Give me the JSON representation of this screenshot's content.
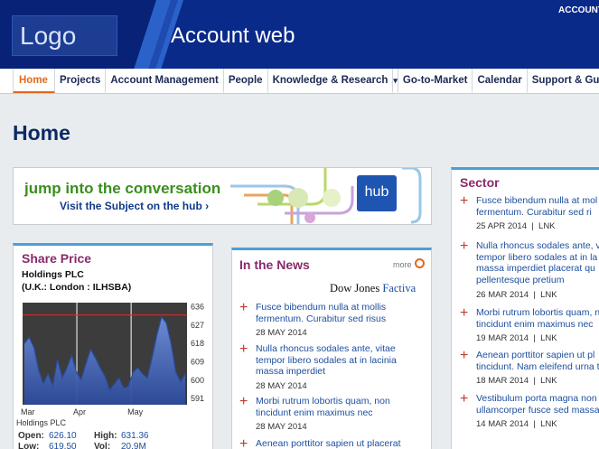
{
  "header": {
    "logo": "Logo",
    "title": "Account web",
    "account_link": "ACCOUNT"
  },
  "nav": {
    "items": [
      "Home",
      "Projects",
      "Account Management",
      "People",
      "Knowledge & Research",
      "▾",
      "Go-to-Market",
      "Calendar",
      "Support & Gu"
    ]
  },
  "page": {
    "title": "Home"
  },
  "banner": {
    "headline": "jump into the conversation",
    "subline": "Visit the Subject on the hub ›",
    "badge": "hub"
  },
  "share_price": {
    "title": "Share Price",
    "company": "Holdings PLC",
    "exchange": "(U.K.: London : ILHSBA)",
    "chart_data": {
      "type": "area",
      "x_labels": [
        "Mar",
        "Apr",
        "May"
      ],
      "y_ticks": [
        591,
        600,
        609,
        618,
        627,
        636
      ],
      "ylim": [
        588,
        638
      ],
      "values": [
        618,
        621,
        616,
        605,
        598,
        603,
        597,
        610,
        601,
        606,
        612,
        604,
        600,
        608,
        615,
        611,
        606,
        602,
        595,
        598,
        601,
        596,
        597,
        604,
        606,
        603,
        601,
        611,
        622,
        631,
        628,
        618,
        604,
        599,
        603
      ],
      "legend": "Holdings PLC",
      "colors": {
        "fill": "#4f78c8",
        "line": "#2a4fa5",
        "reference": "#d03030",
        "background": "#3c3c3c"
      }
    },
    "stats": {
      "open_label": "Open:",
      "open": "626.10",
      "high_label": "High:",
      "high": "631.36",
      "low_label": "Low:",
      "low": "619.50",
      "vol_label": "Vol:",
      "vol": "20.9M"
    }
  },
  "news": {
    "title": "In the News",
    "more": "more",
    "source_a": "Dow Jones",
    "source_b": "Factiva",
    "items": [
      {
        "text": "Fusce bibendum nulla at mollis fermentum. Curabitur sed risus",
        "date": "28 MAY 2014"
      },
      {
        "text": "Nulla rhoncus sodales ante, vitae tempor libero sodales at in lacinia massa imperdiet",
        "date": "28 MAY 2014"
      },
      {
        "text": "Morbi rutrum lobortis quam, non tincidunt enim maximus nec",
        "date": "28 MAY 2014"
      },
      {
        "text": "Aenean porttitor sapien ut placerat",
        "date": ""
      }
    ]
  },
  "sector": {
    "title": "Sector",
    "items": [
      {
        "text": "Fusce bibendum nulla at mol fermentum. Curabitur sed ri",
        "date": "25 APR 2014",
        "source": "LNK"
      },
      {
        "text": "Nulla rhoncus sodales ante, v tempor libero sodales at in la massa imperdiet placerat qu pellentesque pretium",
        "date": "26 MAR 2014",
        "source": "LNK"
      },
      {
        "text": "Morbi rutrum lobortis quam, n tincidunt enim maximus nec",
        "date": "19 MAR 2014",
        "source": "LNK"
      },
      {
        "text": "Aenean porttitor sapien ut pl tincidunt. Nam eleifend urna t",
        "date": "18 MAR 2014",
        "source": "LNK"
      },
      {
        "text": "Vestibulum porta magna non ullamcorper fusce sed massa",
        "date": "14 MAR 2014",
        "source": "LNK"
      }
    ]
  }
}
